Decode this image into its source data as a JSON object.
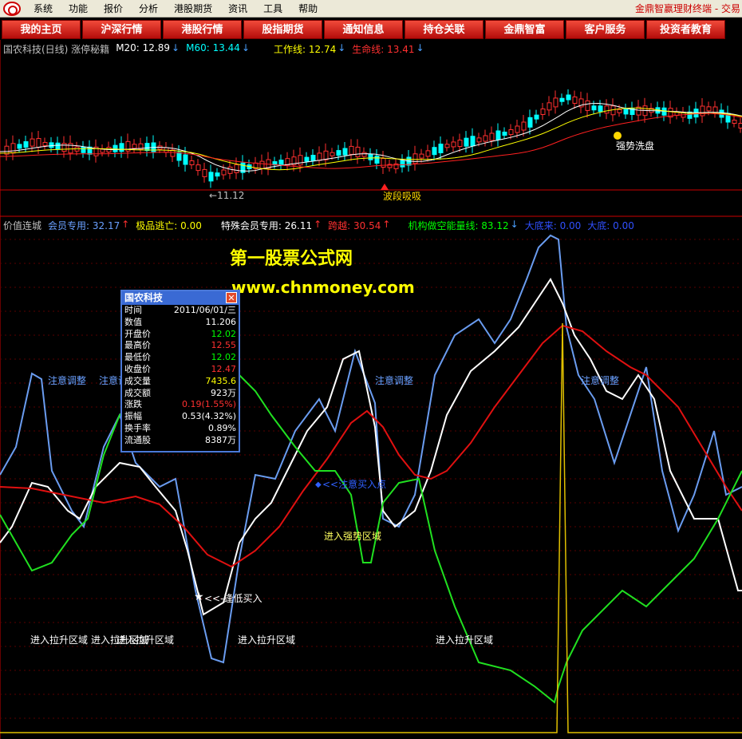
{
  "menubar": {
    "items": [
      "系统",
      "功能",
      "报价",
      "分析",
      "港股期货",
      "资讯",
      "工具",
      "帮助"
    ],
    "app_title": "金鼎智赢理财终端 - 交易"
  },
  "navbar": {
    "buttons": [
      "我的主页",
      "沪深行情",
      "港股行情",
      "股指期货",
      "通知信息",
      "持仓关联",
      "金鼎智富",
      "客户服务",
      "投资者教育"
    ]
  },
  "upper_panel": {
    "stock_title": "国农科技(日线) 涨停秘籍",
    "m20": "M20: 12.89",
    "m60": "M60: 13.44",
    "work_line": "工作线: 12.74",
    "life_line": "生命线: 13.41",
    "low_marker": "←11.12",
    "signal_wave": "波段吸吸",
    "signal_wash": "强势洗盘",
    "colors": {
      "m20": "#ffffff",
      "m60": "#00ffff",
      "work": "#ffff00",
      "life": "#ff3030",
      "up": "#ff3030",
      "down": "#00ffff"
    }
  },
  "lower_panel": {
    "indicator_name": "价值连城",
    "member": "会员专用: 32.17",
    "escape": "极品逃亡: 0.00",
    "special": "特殊会员专用: 26.11",
    "leap": "跨越: 30.54",
    "inst": "机构做空能量线: 83.12",
    "bottom1": "大底来: 0.00",
    "bottom2": "大底: 0.00",
    "annotations": {
      "caution": "注意调整",
      "lift_zone": "进入拉升区域",
      "strong_zone": "进入强势区域",
      "careful_buy": "<<注意买入点",
      "bottom_buy": "<<-逢低买入"
    }
  },
  "watermark": {
    "line1": "第一股票公式网",
    "line2": "www.chnmoney.com"
  },
  "info_popup": {
    "title": "国农科技",
    "rows": [
      {
        "k": "时间",
        "v": "2011/06/01/三",
        "c": "#ffffff"
      },
      {
        "k": "数值",
        "v": "11.206",
        "c": "#ffffff"
      },
      {
        "k": "开盘价",
        "v": "12.02",
        "c": "#00ff00"
      },
      {
        "k": "最高价",
        "v": "12.55",
        "c": "#ff3030"
      },
      {
        "k": "最低价",
        "v": "12.02",
        "c": "#00ff00"
      },
      {
        "k": "收盘价",
        "v": "12.47",
        "c": "#ff3030"
      },
      {
        "k": "成交量",
        "v": "7435.6",
        "c": "#ffff00"
      },
      {
        "k": "成交额",
        "v": "923万",
        "c": "#ffffff"
      },
      {
        "k": "涨跌",
        "v": "0.19(1.55%)",
        "c": "#ff3030"
      },
      {
        "k": "振幅",
        "v": "0.53(4.32%)",
        "c": "#ffffff"
      },
      {
        "k": "换手率",
        "v": "0.89%",
        "c": "#ffffff"
      },
      {
        "k": "流通股",
        "v": "8387万",
        "c": "#ffffff"
      }
    ]
  }
}
